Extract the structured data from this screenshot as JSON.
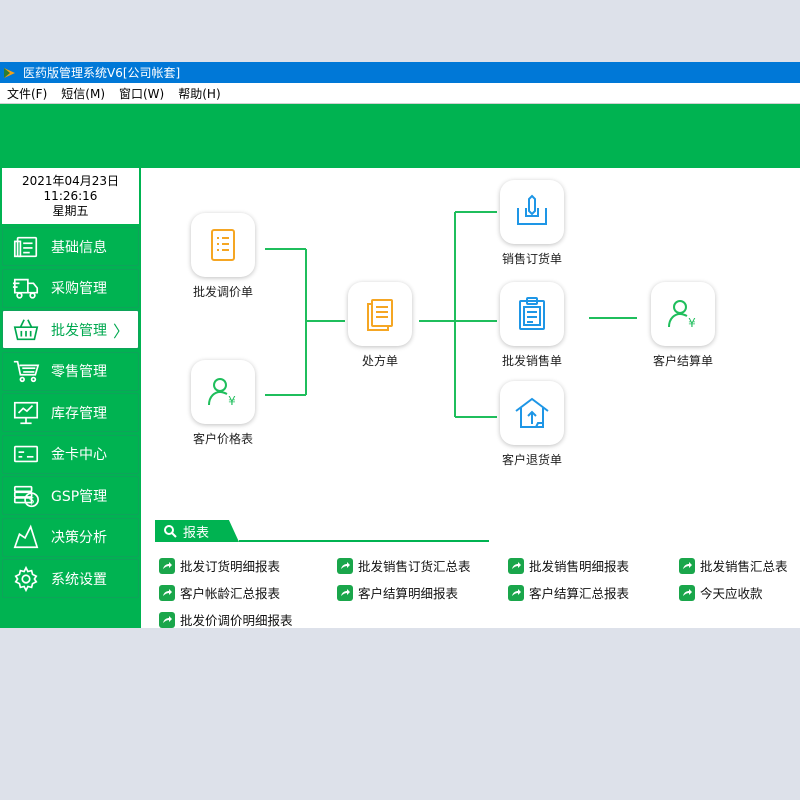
{
  "window": {
    "title": "医药版管理系统V6[公司帐套]"
  },
  "menu": [
    {
      "label": "文件(F)"
    },
    {
      "label": "短信(M)"
    },
    {
      "label": "窗口(W)"
    },
    {
      "label": "帮助(H)"
    }
  ],
  "clock": {
    "date": "2021年04月23日",
    "time": "11:26:16",
    "weekday": "星期五"
  },
  "nav": [
    {
      "label": "基础信息",
      "icon": "info-card-icon"
    },
    {
      "label": "采购管理",
      "icon": "truck-icon"
    },
    {
      "label": "批发管理",
      "icon": "basket-icon",
      "active": true,
      "chevron": "〉"
    },
    {
      "label": "零售管理",
      "icon": "cart-icon"
    },
    {
      "label": "库存管理",
      "icon": "board-icon"
    },
    {
      "label": "金卡中心",
      "icon": "card-icon"
    },
    {
      "label": "GSP管理",
      "icon": "coin-icon"
    },
    {
      "label": "决策分析",
      "icon": "chart-icon"
    },
    {
      "label": "系统设置",
      "icon": "gear-icon"
    }
  ],
  "flow": {
    "nodes": [
      {
        "id": "wholesale-price",
        "label": "批发调价单",
        "icon": "price-list-icon"
      },
      {
        "id": "customer-price",
        "label": "客户价格表",
        "icon": "customer-yen-icon"
      },
      {
        "id": "prescription",
        "label": "处方单",
        "icon": "document-stack-icon"
      },
      {
        "id": "sales-order",
        "label": "销售订货单",
        "icon": "order-tray-icon"
      },
      {
        "id": "wholesale-sales",
        "label": "批发销售单",
        "icon": "clipboard-icon"
      },
      {
        "id": "customer-return",
        "label": "客户退货单",
        "icon": "return-house-icon"
      },
      {
        "id": "customer-settle",
        "label": "客户结算单",
        "icon": "customer-yen-icon"
      }
    ]
  },
  "reports": {
    "title": "报表",
    "rows": [
      [
        "批发订货明细报表",
        "批发销售订货汇总表",
        "批发销售明细报表",
        "批发销售汇总表"
      ],
      [
        "客户帐龄汇总报表",
        "客户结算明细报表",
        "客户结算汇总报表",
        "今天应收款"
      ],
      [
        "批发价调价明细报表"
      ]
    ]
  },
  "colors": {
    "green": "#00b351",
    "blue": "#0078d7",
    "iconBlue": "#1e96e6",
    "iconYellow": "#f5a623"
  }
}
